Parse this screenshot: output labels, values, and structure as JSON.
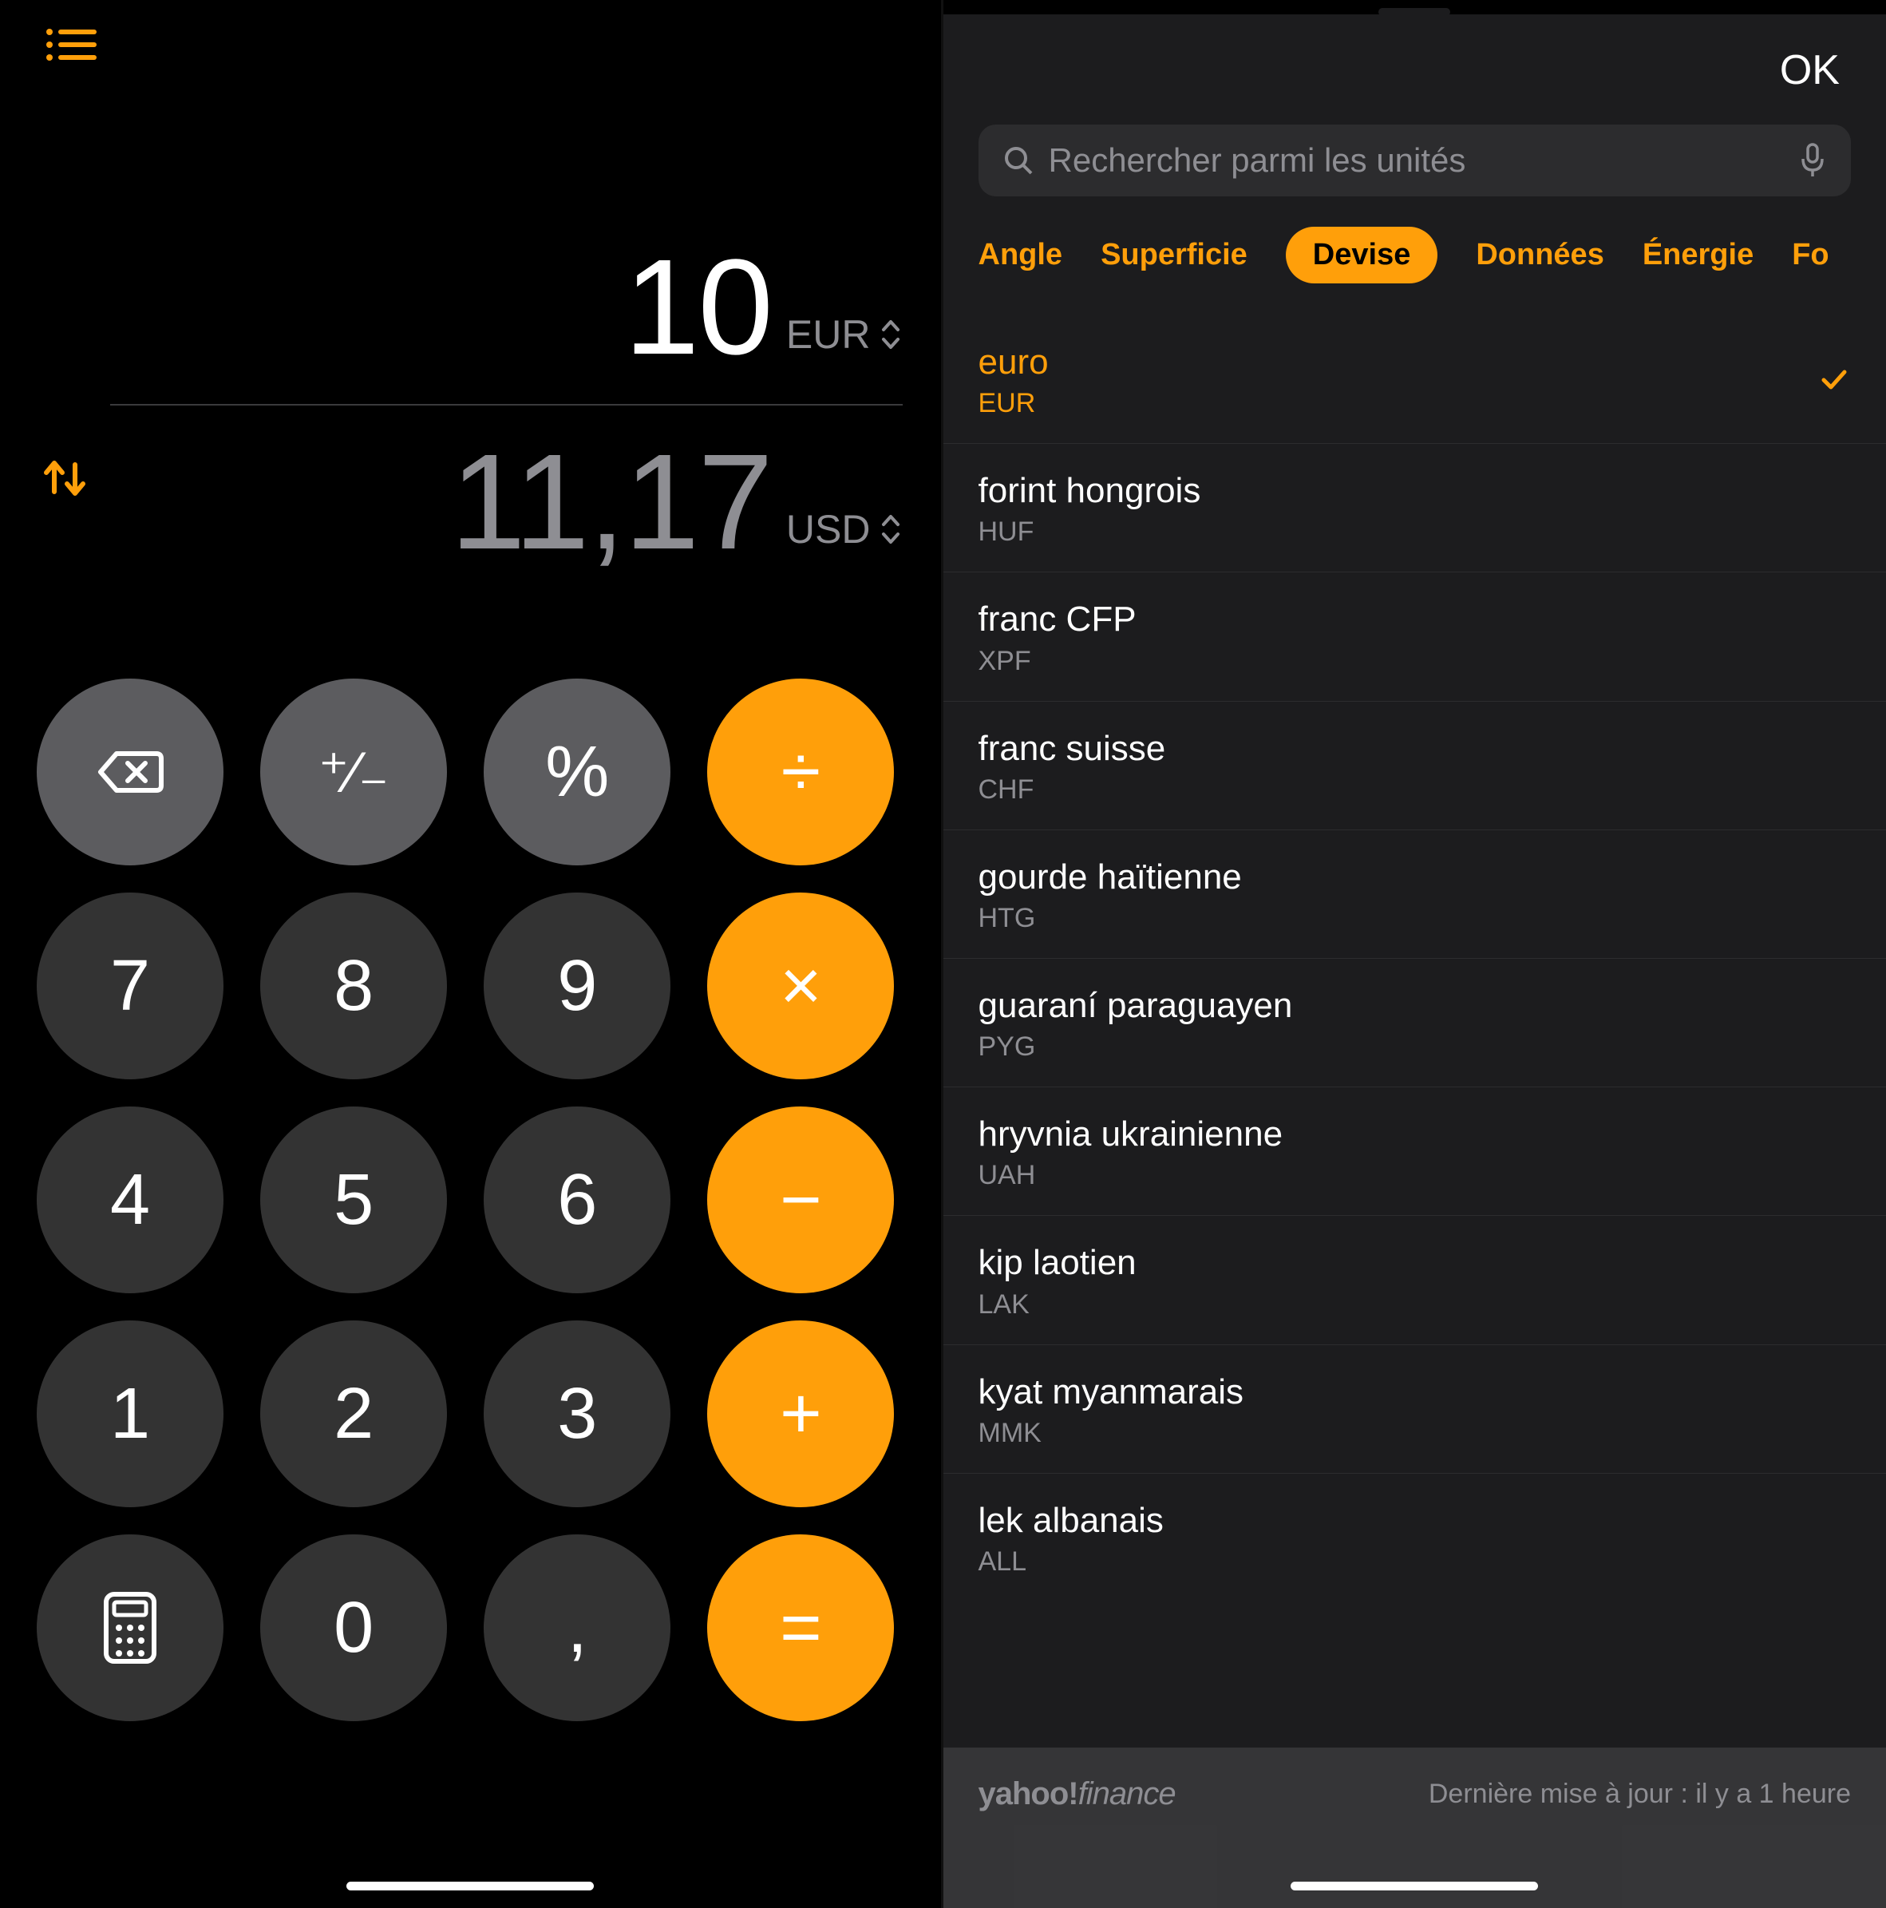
{
  "calc": {
    "primary_value": "10",
    "primary_unit": "EUR",
    "secondary_value": "11,17",
    "secondary_unit": "USD",
    "keys": {
      "plusminus": "⁺∕₋",
      "percent": "%",
      "divide": "÷",
      "k7": "7",
      "k8": "8",
      "k9": "9",
      "mult": "×",
      "k4": "4",
      "k5": "5",
      "k6": "6",
      "minus": "−",
      "k1": "1",
      "k2": "2",
      "k3": "3",
      "plus": "+",
      "k0": "0",
      "comma": ",",
      "equals": "="
    }
  },
  "picker": {
    "ok": "OK",
    "search_placeholder": "Rechercher parmi les unités",
    "tabs": [
      "Angle",
      "Superficie",
      "Devise",
      "Données",
      "Énergie",
      "Fo"
    ],
    "active_tab_index": 2,
    "units": [
      {
        "name": "euro",
        "code": "EUR",
        "selected": true
      },
      {
        "name": "forint hongrois",
        "code": "HUF"
      },
      {
        "name": "franc CFP",
        "code": "XPF"
      },
      {
        "name": "franc suisse",
        "code": "CHF"
      },
      {
        "name": "gourde haïtienne",
        "code": "HTG"
      },
      {
        "name": "guaraní paraguayen",
        "code": "PYG"
      },
      {
        "name": "hryvnia ukrainienne",
        "code": "UAH"
      },
      {
        "name": "kip laotien",
        "code": "LAK"
      },
      {
        "name": "kyat myanmarais",
        "code": "MMK"
      },
      {
        "name": "lek albanais",
        "code": "ALL"
      }
    ],
    "brand": "yahoo!finance",
    "update_text": "Dernière mise à jour : il y a 1 heure"
  }
}
